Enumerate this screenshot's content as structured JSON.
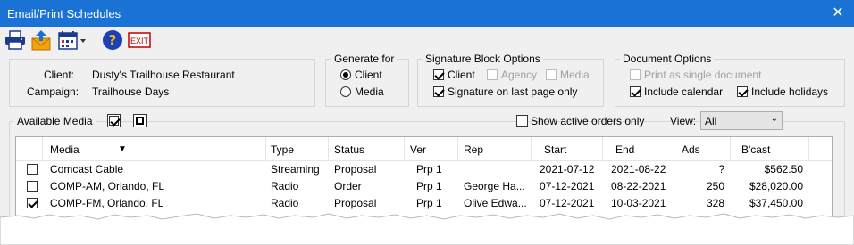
{
  "window": {
    "title": "Email/Print Schedules"
  },
  "toolbar": {
    "buttons": [
      {
        "icon": "printer-icon"
      },
      {
        "icon": "email-export-icon"
      },
      {
        "icon": "calendar-dropdown-icon"
      },
      {
        "icon": "help-icon"
      },
      {
        "icon": "exit-icon",
        "label": "EXIT"
      }
    ]
  },
  "info": {
    "client_label": "Client:",
    "client_value": "Dusty's Trailhouse Restaurant",
    "campaign_label": "Campaign:",
    "campaign_value": "Trailhouse Days"
  },
  "generate_for": {
    "title": "Generate for",
    "options": [
      {
        "label": "Client",
        "selected": true
      },
      {
        "label": "Media",
        "selected": false
      }
    ]
  },
  "signature": {
    "title": "Signature Block Options",
    "client": {
      "label": "Client",
      "checked": true
    },
    "agency": {
      "label": "Agency",
      "checked": false,
      "disabled": true
    },
    "media": {
      "label": "Media",
      "checked": false,
      "disabled": true
    },
    "last_page": {
      "label": "Signature on last page only",
      "checked": true
    }
  },
  "document": {
    "title": "Document Options",
    "single": {
      "label": "Print as single document",
      "checked": false,
      "disabled": true
    },
    "calendar": {
      "label": "Include calendar",
      "checked": true
    },
    "holidays": {
      "label": "Include holidays",
      "checked": true
    }
  },
  "media_bar": {
    "available_label": "Available Media",
    "show_active_label": "Show active orders only",
    "view_label": "View:",
    "view_value": "All"
  },
  "table": {
    "columns": [
      "Media",
      "Type",
      "Status",
      "Ver",
      "Rep",
      "Start",
      "End",
      "Ads",
      "B'cast"
    ],
    "sort_indicator": "▼",
    "rows": [
      {
        "checked": false,
        "cells": [
          "Comcast Cable",
          "Streaming",
          "Proposal",
          "Prp 1",
          "",
          "2021-07-12",
          "2021-08-22",
          "?",
          "$562.50"
        ]
      },
      {
        "checked": false,
        "cells": [
          "COMP-AM, Orlando, FL",
          "Radio",
          "Order",
          "Prp 1",
          "George Ha...",
          "07-12-2021",
          "08-22-2021",
          "250",
          "$28,020.00"
        ]
      },
      {
        "checked": true,
        "cells": [
          "COMP-FM, Orlando, FL",
          "Radio",
          "Proposal",
          "Prp 1",
          "Olive Edwa...",
          "07-12-2021",
          "10-03-2021",
          "328",
          "$37,450.00"
        ]
      }
    ]
  },
  "colors": {
    "titlebar": "#1a73d4",
    "background": "#f0f0f0"
  }
}
